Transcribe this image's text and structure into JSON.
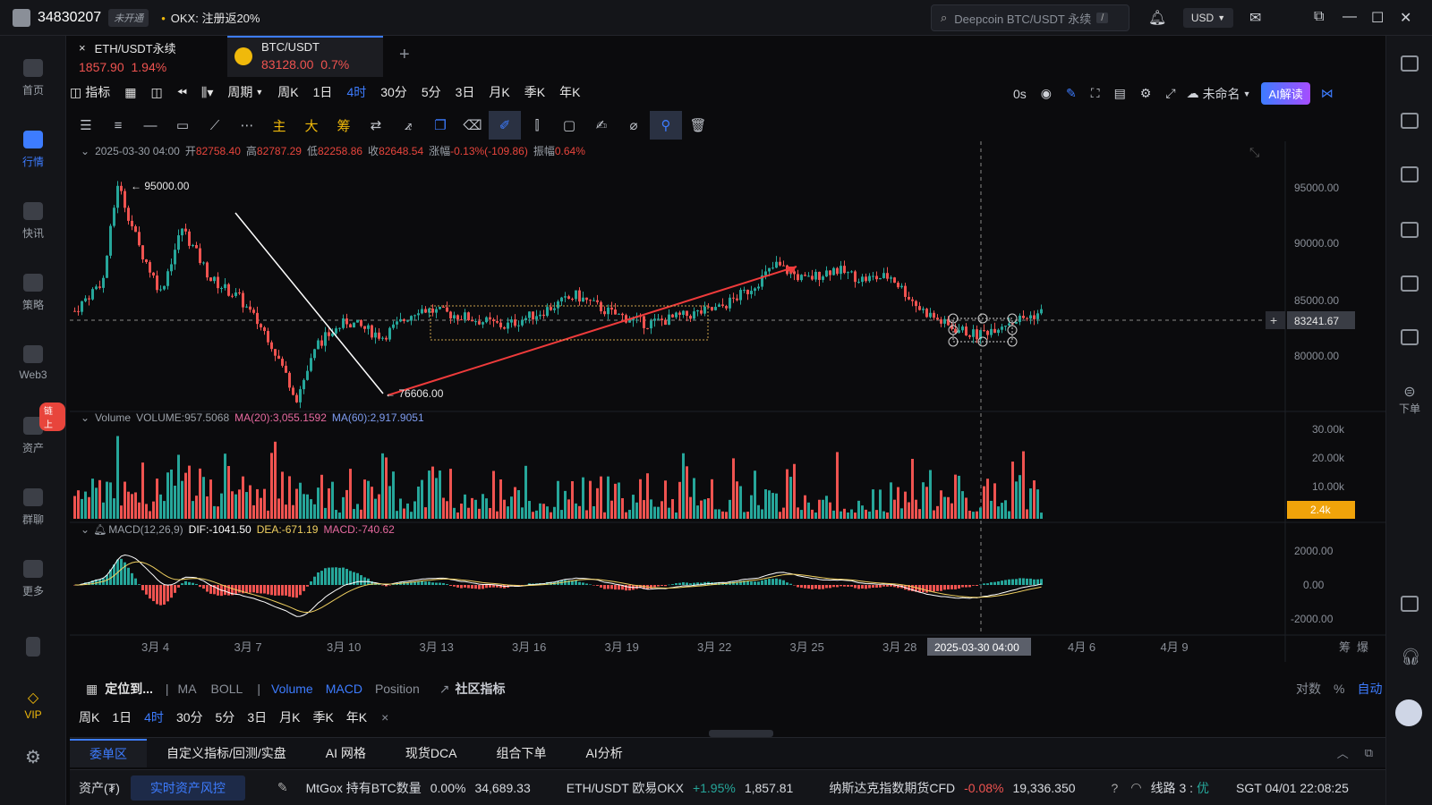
{
  "topbar": {
    "user_id": "34830207",
    "status_badge": "未开通",
    "promo_name": "OKX:",
    "promo_text": "注册返20%",
    "search_placeholder": "Deepcoin BTC/USDT 永续",
    "search_shortcut": "/",
    "currency": "USD"
  },
  "sidebar": {
    "items": [
      {
        "label": "首页",
        "icon": "home-icon"
      },
      {
        "label": "行情",
        "icon": "market-icon",
        "active": true
      },
      {
        "label": "快讯",
        "icon": "news-icon"
      },
      {
        "label": "策略",
        "icon": "strategy-icon"
      },
      {
        "label": "Web3",
        "icon": "web3-icon"
      },
      {
        "label": "资产",
        "icon": "wallet-icon",
        "badge": "链上"
      },
      {
        "label": "群聊",
        "icon": "chat-icon"
      },
      {
        "label": "更多",
        "icon": "more-icon"
      }
    ],
    "vip_label": "VIP"
  },
  "rightbar": {
    "order_label": "下单"
  },
  "tabs": [
    {
      "name": "ETH/USDT永续",
      "price": "1857.90",
      "change": "1.94%",
      "close": "×"
    },
    {
      "name": "BTC/USDT",
      "price": "83128.00",
      "change": "0.7%"
    }
  ],
  "toolbar": {
    "indicator_label": "指标",
    "period_label": "周期",
    "intervals": [
      "周K",
      "1日",
      "4时",
      "30分",
      "5分",
      "3日",
      "月K",
      "季K",
      "年K"
    ],
    "active_interval": "4时",
    "countdown": "0s",
    "layout_name": "未命名",
    "ai_button": "AI解读"
  },
  "drawing_tools": {
    "text_tools": [
      "主",
      "大",
      "筹"
    ]
  },
  "chart_info": {
    "date": "2025-03-30 04:00",
    "open_label": "开",
    "open": "82758.40",
    "high_label": "高",
    "high": "82787.29",
    "low_label": "低",
    "low": "82258.86",
    "close_label": "收",
    "close": "82648.54",
    "change_label": "涨幅",
    "change": "-0.13%(-109.86)",
    "amp_label": "振幅",
    "amp": "0.64%",
    "high_marker": "95000.00",
    "low_marker": "76606.00",
    "price_axis": [
      "95000.00",
      "90000.00",
      "85000.00",
      "80000.00"
    ],
    "crosshair_price": "83241.67"
  },
  "volume_info": {
    "title": "Volume",
    "volume": "VOLUME:957.5068",
    "ma20": "MA(20):3,055.1592",
    "ma60": "MA(60):2,917.9051",
    "axis": [
      "30.00k",
      "20.00k",
      "10.00k"
    ],
    "current": "2.4k"
  },
  "macd_info": {
    "title": "MACD(12,26,9)",
    "dif": "DIF:-1041.50",
    "dea": "DEA:-671.19",
    "macd": "MACD:-740.62",
    "axis": [
      "2000.00",
      "0.00",
      "-2000.00"
    ]
  },
  "xaxis": {
    "labels": [
      "3月 4",
      "3月 7",
      "3月 10",
      "3月 13",
      "3月 16",
      "3月 19",
      "3月 22",
      "3月 25",
      "3月 28",
      "4月 3",
      "4月 6",
      "4月 9"
    ],
    "cursor_label": "2025-03-30 04:00",
    "right_labels": [
      "筹",
      "爆"
    ]
  },
  "indicator_bar": {
    "locate_label": "定位到...",
    "items": [
      "MA",
      "BOLL",
      "Volume",
      "MACD",
      "Position"
    ],
    "active": [
      "Volume",
      "MACD"
    ],
    "community": "社区指标",
    "log_label": "对数",
    "pct_label": "%",
    "auto_label": "自动"
  },
  "period_bar": {
    "items": [
      "周K",
      "1日",
      "4时",
      "30分",
      "5分",
      "3日",
      "月K",
      "季K",
      "年K"
    ],
    "active": "4时",
    "close": "×"
  },
  "bottom_tabs": [
    "委单区",
    "自定义指标/回测/实盘",
    "AI 网格",
    "现货DCA",
    "组合下单",
    "AI分析"
  ],
  "statusbar": {
    "assets": "资产(₮)",
    "risk_button": "实时资产风控",
    "ticker1_name": "MtGox 持有BTC数量",
    "ticker1_change": "0.00%",
    "ticker1_value": "34,689.33",
    "ticker2_name": "ETH/USDT 欧易OKX",
    "ticker2_change": "+1.95%",
    "ticker2_value": "1,857.81",
    "ticker3_name": "纳斯达克指数期货CFD",
    "ticker3_change": "-0.08%",
    "ticker3_value": "19,336.350",
    "line_label": "线路 3 :",
    "line_quality": "优",
    "clock": "SGT 04/01 22:08:25"
  },
  "colors": {
    "up": "#26a69a",
    "down": "#ef5350",
    "accent": "#3d7cff",
    "gold": "#f0b90b"
  },
  "chart_data": {
    "type": "candlestick",
    "interval": "4时",
    "y_range": [
      76000,
      97000
    ],
    "price_ticks": [
      95000,
      90000,
      85000,
      80000
    ],
    "high": 95000.0,
    "low": 76606.0,
    "crosshair_price": 83241.67,
    "trend_path": [
      [
        0,
        84000
      ],
      [
        8,
        86500
      ],
      [
        12,
        94000
      ],
      [
        18,
        89000
      ],
      [
        24,
        85500
      ],
      [
        30,
        90500
      ],
      [
        38,
        86500
      ],
      [
        46,
        85000
      ],
      [
        54,
        82000
      ],
      [
        62,
        77200
      ],
      [
        68,
        81500
      ],
      [
        76,
        83200
      ],
      [
        86,
        82000
      ],
      [
        96,
        84200
      ],
      [
        108,
        83600
      ],
      [
        120,
        82800
      ],
      [
        130,
        83900
      ],
      [
        140,
        85200
      ],
      [
        150,
        83800
      ],
      [
        160,
        83000
      ],
      [
        170,
        83600
      ],
      [
        180,
        84200
      ],
      [
        188,
        85600
      ],
      [
        196,
        87600
      ],
      [
        204,
        86400
      ],
      [
        212,
        87300
      ],
      [
        220,
        86500
      ],
      [
        228,
        86700
      ],
      [
        236,
        84200
      ],
      [
        244,
        82800
      ],
      [
        252,
        82100
      ],
      [
        260,
        83100
      ],
      [
        266,
        83500
      ],
      [
        270,
        83900
      ]
    ],
    "volume_axis": [
      30000,
      20000,
      10000
    ],
    "macd_axis": [
      2000,
      0,
      -2000
    ]
  }
}
